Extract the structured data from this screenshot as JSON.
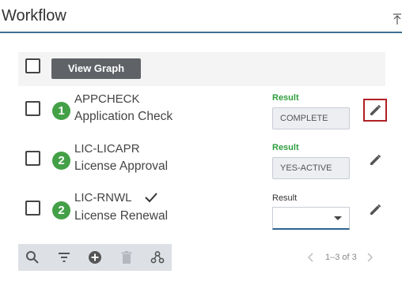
{
  "header": {
    "title": "Workflow"
  },
  "toolbar_top": {
    "view_graph_label": "View Graph"
  },
  "rows": [
    {
      "step": "1",
      "code": "APPCHECK",
      "description": "Application Check",
      "result_label": "Result",
      "result_value": "COMPLETE"
    },
    {
      "step": "2",
      "code": "LIC-LICAPR",
      "description": "License Approval",
      "result_label": "Result",
      "result_value": "YES-ACTIVE"
    },
    {
      "step": "2",
      "code": "LIC-RNWL",
      "description": "License Renewal",
      "result_label": "Result",
      "result_value": ""
    }
  ],
  "pager": {
    "text": "1–3 of 3"
  },
  "colors": {
    "accent": "#3f6f8f",
    "badge": "#43a047",
    "result_ok": "#2e9e3e",
    "focus_ring": "#b02025"
  },
  "icons": [
    "collapse-icon",
    "check-icon",
    "edit-icon",
    "search-icon",
    "filter-icon",
    "add-icon",
    "delete-icon",
    "workflow-icon",
    "chevron-left-icon",
    "chevron-right-icon"
  ]
}
